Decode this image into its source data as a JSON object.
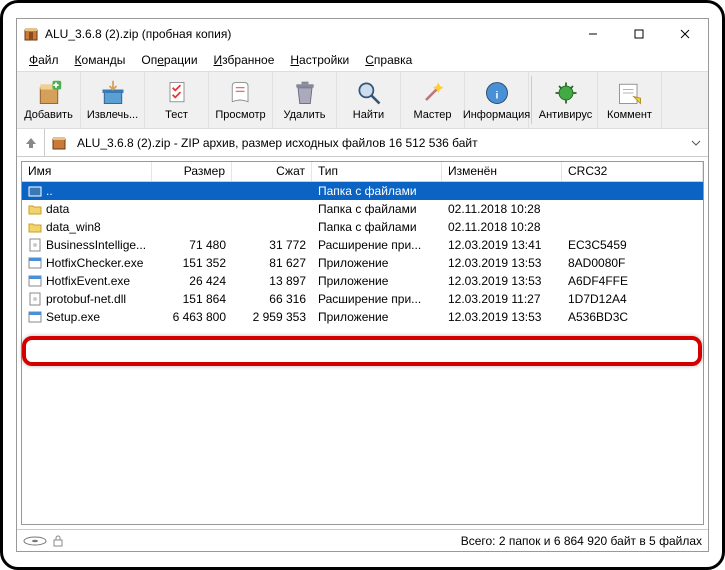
{
  "window": {
    "title": "ALU_3.6.8 (2).zip (пробная копия)"
  },
  "menu": {
    "file": "Файл",
    "commands": "Команды",
    "operations": "Операции",
    "favorites": "Избранное",
    "settings": "Настройки",
    "help": "Справка"
  },
  "toolbar": {
    "add": "Добавить",
    "extract": "Извлечь...",
    "test": "Тест",
    "view": "Просмотр",
    "delete": "Удалить",
    "find": "Найти",
    "wizard": "Мастер",
    "info": "Информация",
    "antivirus": "Антивирус",
    "comment": "Коммент"
  },
  "path": "ALU_3.6.8 (2).zip - ZIP архив, размер исходных файлов 16 512 536 байт",
  "columns": {
    "name": "Имя",
    "size": "Размер",
    "packed": "Сжат",
    "type": "Тип",
    "modified": "Изменён",
    "crc": "CRC32"
  },
  "rows": [
    {
      "icon": "up",
      "name": "..",
      "size": "",
      "packed": "",
      "type": "Папка с файлами",
      "modified": "",
      "crc": "",
      "selected": true
    },
    {
      "icon": "folder",
      "name": "data",
      "size": "",
      "packed": "",
      "type": "Папка с файлами",
      "modified": "02.11.2018 10:28",
      "crc": ""
    },
    {
      "icon": "folder",
      "name": "data_win8",
      "size": "",
      "packed": "",
      "type": "Папка с файлами",
      "modified": "02.11.2018 10:28",
      "crc": ""
    },
    {
      "icon": "dll",
      "name": "BusinessIntellige...",
      "size": "71 480",
      "packed": "31 772",
      "type": "Расширение при...",
      "modified": "12.03.2019 13:41",
      "crc": "EC3C5459"
    },
    {
      "icon": "exe",
      "name": "HotfixChecker.exe",
      "size": "151 352",
      "packed": "81 627",
      "type": "Приложение",
      "modified": "12.03.2019 13:53",
      "crc": "8AD0080F"
    },
    {
      "icon": "exe",
      "name": "HotfixEvent.exe",
      "size": "26 424",
      "packed": "13 897",
      "type": "Приложение",
      "modified": "12.03.2019 13:53",
      "crc": "A6DF4FFE"
    },
    {
      "icon": "dll",
      "name": "protobuf-net.dll",
      "size": "151 864",
      "packed": "66 316",
      "type": "Расширение при...",
      "modified": "12.03.2019 11:27",
      "crc": "1D7D12A4"
    },
    {
      "icon": "exe",
      "name": "Setup.exe",
      "size": "6 463 800",
      "packed": "2 959 353",
      "type": "Приложение",
      "modified": "12.03.2019 13:53",
      "crc": "A536BD3C"
    }
  ],
  "status": "Всего: 2 папок и 6 864 920 байт в 5 файлах"
}
